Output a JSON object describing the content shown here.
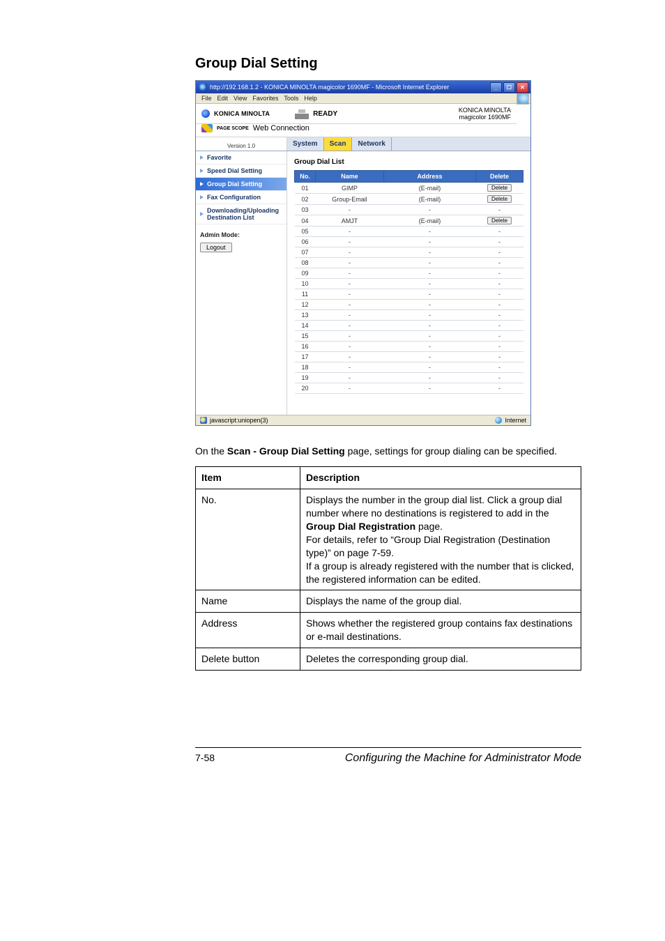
{
  "section_title": "Group Dial Setting",
  "browser": {
    "title": "http://192.168.1.2 - KONICA MINOLTA magicolor 1690MF - Microsoft Internet Explorer",
    "menu": [
      "File",
      "Edit",
      "View",
      "Favorites",
      "Tools",
      "Help"
    ],
    "status_left": "javascript:uniopen(3)",
    "status_right": "Internet"
  },
  "header": {
    "brand": "KONICA MINOLTA",
    "status": "READY",
    "right_brand": "KONICA MINOLTA",
    "right_model": "magicolor 1690MF",
    "webconn_prefix": "PAGE SCOPE",
    "webconn": "Web Connection",
    "version": "Version 1.0"
  },
  "tabs": {
    "system": "System",
    "scan": "Scan",
    "network": "Network"
  },
  "sidebar": {
    "items": [
      "Favorite",
      "Speed Dial Setting",
      "Group Dial Setting",
      "Fax Configuration",
      "Downloading/Uploading Destination List"
    ],
    "admin_label": "Admin Mode:",
    "logout": "Logout"
  },
  "panel": {
    "title": "Group Dial List",
    "cols": {
      "no": "No.",
      "name": "Name",
      "address": "Address",
      "delete": "Delete"
    },
    "delete_label": "Delete",
    "rows": [
      {
        "no": "01",
        "name": "GIMP",
        "address": "(E-mail)",
        "has_delete": true
      },
      {
        "no": "02",
        "name": "Group-Email",
        "address": "(E-mail)",
        "has_delete": true
      },
      {
        "no": "03",
        "name": "-",
        "address": "-",
        "has_delete": false
      },
      {
        "no": "04",
        "name": "AMJT",
        "address": "(E-mail)",
        "has_delete": true
      },
      {
        "no": "05",
        "name": "-",
        "address": "-",
        "has_delete": false
      },
      {
        "no": "06",
        "name": "-",
        "address": "-",
        "has_delete": false
      },
      {
        "no": "07",
        "name": "-",
        "address": "-",
        "has_delete": false
      },
      {
        "no": "08",
        "name": "-",
        "address": "-",
        "has_delete": false
      },
      {
        "no": "09",
        "name": "-",
        "address": "-",
        "has_delete": false
      },
      {
        "no": "10",
        "name": "-",
        "address": "-",
        "has_delete": false
      },
      {
        "no": "11",
        "name": "-",
        "address": "-",
        "has_delete": false
      },
      {
        "no": "12",
        "name": "-",
        "address": "-",
        "has_delete": false
      },
      {
        "no": "13",
        "name": "-",
        "address": "-",
        "has_delete": false
      },
      {
        "no": "14",
        "name": "-",
        "address": "-",
        "has_delete": false
      },
      {
        "no": "15",
        "name": "-",
        "address": "-",
        "has_delete": false
      },
      {
        "no": "16",
        "name": "-",
        "address": "-",
        "has_delete": false
      },
      {
        "no": "17",
        "name": "-",
        "address": "-",
        "has_delete": false
      },
      {
        "no": "18",
        "name": "-",
        "address": "-",
        "has_delete": false
      },
      {
        "no": "19",
        "name": "-",
        "address": "-",
        "has_delete": false
      },
      {
        "no": "20",
        "name": "-",
        "address": "-",
        "has_delete": false
      }
    ]
  },
  "caption": {
    "prefix": "On the ",
    "bold": "Scan - Group Dial Setting",
    "suffix": " page, settings for group dialing can be specified."
  },
  "desc_table": {
    "headers": {
      "item": "Item",
      "desc": "Description"
    },
    "rows": [
      {
        "item": "No.",
        "desc_html": "Displays the number in the group dial list. Click a group dial number where no destinations is registered to add in the <b>Group Dial Registration</b> page.<br>For details, refer to “Group Dial Registration (Destination type)” on page 7-59.<br>If a group is already registered with the number that is clicked, the registered information can be edited."
      },
      {
        "item": "Name",
        "desc_html": "Displays the name of the group dial."
      },
      {
        "item": "Address",
        "desc_html": "Shows whether the registered group contains fax destinations or e-mail destinations."
      },
      {
        "item": "Delete button",
        "desc_html": "Deletes the corresponding group dial."
      }
    ]
  },
  "footer": {
    "pagenum": "7-58",
    "text": "Configuring the Machine for Administrator Mode"
  }
}
